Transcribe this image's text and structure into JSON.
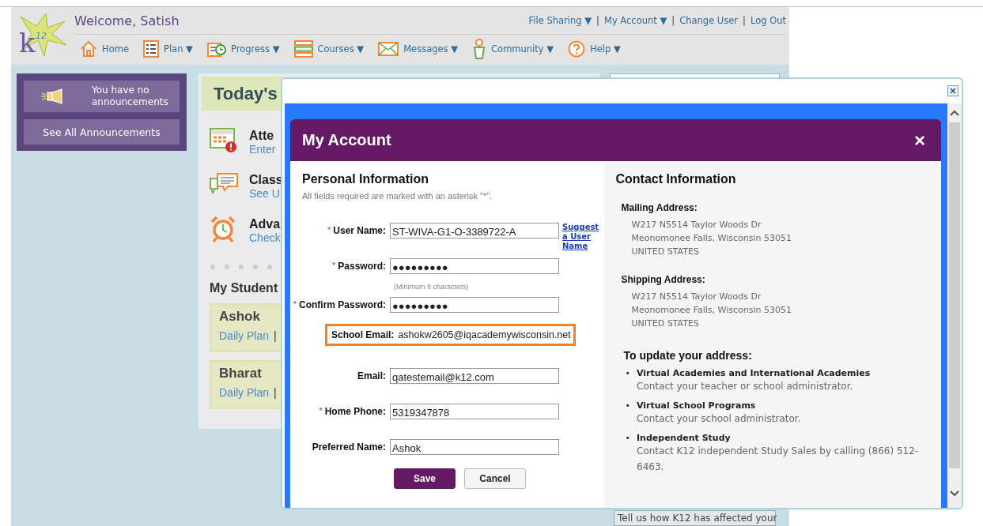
{
  "logo": {
    "letter": "k",
    "number": "12"
  },
  "header": {
    "welcome": "Welcome, Satish",
    "top_links": [
      {
        "kind": "link",
        "label": "File Sharing ▼"
      },
      {
        "kind": "separator",
        "label": "|"
      },
      {
        "kind": "link",
        "label": "My Account ▼"
      },
      {
        "kind": "separator",
        "label": "|"
      },
      {
        "kind": "link",
        "label": "Change User"
      },
      {
        "kind": "separator",
        "label": "|"
      },
      {
        "kind": "link",
        "label": "Log Out"
      }
    ],
    "nav": [
      {
        "label": "Home"
      },
      {
        "label": "Plan ▼"
      },
      {
        "label": "Progress ▼"
      },
      {
        "label": "Courses ▼"
      },
      {
        "label": "Messages ▼"
      },
      {
        "label": "Community ▼"
      },
      {
        "label": "Help ▼"
      }
    ]
  },
  "announcements": {
    "message": "You have no announcements",
    "button": "See All Announcements"
  },
  "today": {
    "title": "Today's",
    "items": [
      {
        "title": "Atte",
        "subtitle": "Enter"
      },
      {
        "title": "Class",
        "subtitle": "See U"
      },
      {
        "title": "Adva",
        "subtitle": "Check"
      }
    ]
  },
  "students": {
    "title": "My Student",
    "items": [
      {
        "name": "Ashok",
        "link": "Daily Plan",
        "separator": "|"
      },
      {
        "name": "Bharat",
        "link": "Daily Plan",
        "separator": "|"
      }
    ]
  },
  "side_panel": {
    "text": "Tell us how K12 has affected your"
  },
  "modal": {
    "title": "My Account",
    "close": "×",
    "personal": {
      "heading": "Personal Information",
      "note": "All fields required are marked with an asterisk \"*\".",
      "fields": [
        {
          "kind": "input",
          "marker": "*",
          "label": "User Name:",
          "value": "ST-WIVA-G1-O-3389722-A",
          "link": "Suggest a User Name"
        },
        {
          "kind": "input",
          "marker": "*",
          "label": "Password:",
          "value": "●●●●●●●●●",
          "hint": "(Minimum 8 characters)"
        },
        {
          "kind": "input",
          "marker": "*",
          "label": "Confirm Password:",
          "value": "●●●●●●●●●"
        },
        {
          "kind": "static",
          "label": "School Email:",
          "value": "ashokw2605@iqacademywisconsin.net",
          "highlighted": true
        },
        {
          "kind": "input",
          "label": "Email:",
          "value": "qatestemail@k12.com"
        },
        {
          "kind": "input",
          "marker": "*",
          "label": "Home Phone:",
          "value": "5319347878"
        },
        {
          "kind": "input",
          "label": "Preferred Name:",
          "value": "Ashok"
        }
      ],
      "buttons": [
        {
          "kind": "primary",
          "label": "Save"
        },
        {
          "kind": "secondary",
          "label": "Cancel"
        }
      ]
    },
    "contact": {
      "heading": "Contact Information",
      "addresses": [
        {
          "label": "Mailing Address:",
          "lines": [
            "W217 N5514 Taylor Woods Dr",
            "Meonomonee Falls, Wisconsin 53051",
            "UNITED STATES"
          ]
        },
        {
          "label": "Shipping Address:",
          "lines": [
            "W217 N5514 Taylor Woods Dr",
            "Meonomonee Falls, Wisconsin 53051",
            "UNITED STATES"
          ]
        }
      ],
      "update_heading": "To update your address:",
      "update_items": [
        {
          "bullet": "•",
          "title": "Virtual Academies and International Academies",
          "text": "Contact your teacher or school administrator."
        },
        {
          "bullet": "•",
          "title": "Virtual School Programs",
          "text": "Contact your school administrator."
        },
        {
          "bullet": "•",
          "title": "Independent Study",
          "text": "Contact K12 independent Study Sales by calling (866) 512-6463."
        }
      ]
    }
  }
}
